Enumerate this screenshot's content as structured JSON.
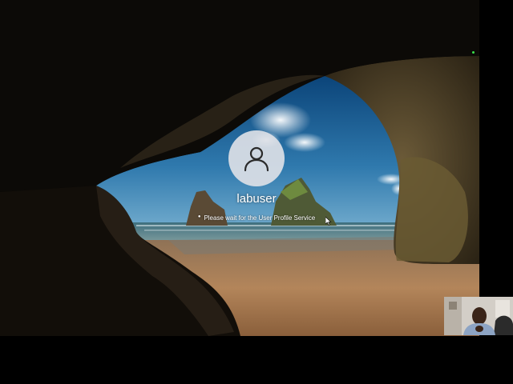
{
  "login": {
    "username": "labuser",
    "status_message": "Please wait for the User Profile Service"
  },
  "icons": {
    "avatar": "user-silhouette-icon",
    "spinner": "loading-spinner-icon",
    "cursor": "mouse-pointer-icon"
  },
  "colors": {
    "background": "#000000",
    "sky_top": "#0f4d86",
    "sky_horizon": "#66a8cc",
    "sea": "#4e7b88",
    "sand": "#b6865a",
    "cave_rock": "#2a2316",
    "avatar_circle": "#dce0e6",
    "text": "#ffffff",
    "indicator": "#3be04a"
  }
}
